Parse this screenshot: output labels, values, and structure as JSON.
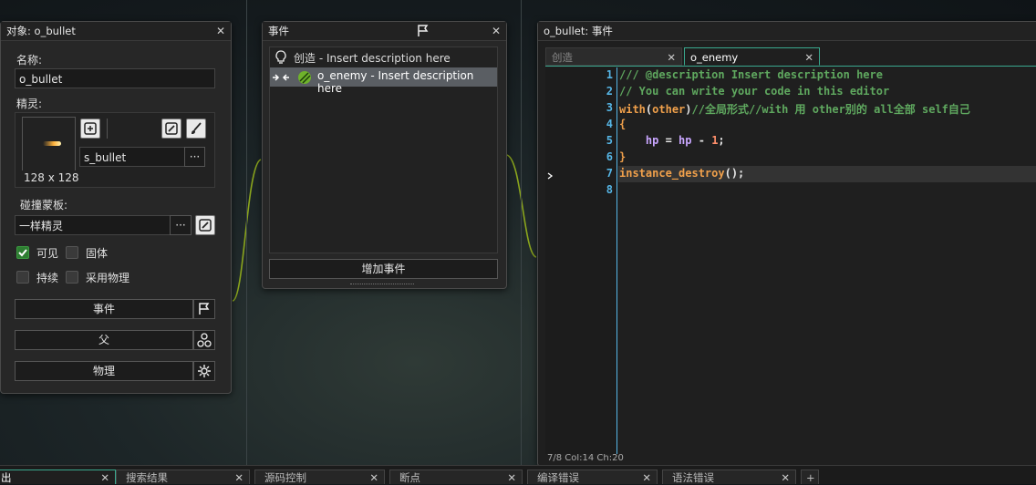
{
  "object_panel": {
    "title": "对象: o_bullet",
    "name_label": "名称:",
    "name_value": "o_bullet",
    "sprite_label": "精灵:",
    "sprite_name": "s_bullet",
    "sprite_size": "128 x 128",
    "ellipsis": "···",
    "collision_label": "碰撞蒙板:",
    "collision_value": "一样精灵",
    "visible_label": "可见",
    "solid_label": "固体",
    "persistent_label": "持续",
    "physics_use_label": "采用物理",
    "visible_checked": true,
    "solid_checked": false,
    "persistent_checked": false,
    "physics_checked": false,
    "events_button": "事件",
    "parent_button": "父",
    "physics_button": "物理"
  },
  "events_panel": {
    "title": "事件",
    "events": [
      {
        "label": "创造 - Insert description here",
        "icon": "lightbulb-icon",
        "selected": false
      },
      {
        "label": "o_enemy - Insert description here",
        "icon": "collision-icon",
        "selected": true
      }
    ],
    "add_event_button": "增加事件"
  },
  "code_panel": {
    "title": "o_bullet: 事件",
    "tabs": [
      {
        "label": "创造",
        "active": false
      },
      {
        "label": "o_enemy",
        "active": true
      }
    ],
    "lines": [
      {
        "num": "1",
        "parts": [
          {
            "t": "/// @description Insert description here",
            "c": "#5fa85f"
          }
        ]
      },
      {
        "num": "2",
        "parts": [
          {
            "t": "// You can write your code in this editor",
            "c": "#5fa85f"
          }
        ]
      },
      {
        "num": "3",
        "parts": [
          {
            "t": "with",
            "c": "#f0a04b"
          },
          {
            "t": "(",
            "c": "#e6e6e6"
          },
          {
            "t": "other",
            "c": "#f0a04b"
          },
          {
            "t": ")",
            "c": "#e6e6e6"
          },
          {
            "t": "//全局形式//with 用 other别的 all全部 self自己",
            "c": "#5fa85f"
          }
        ]
      },
      {
        "num": "4",
        "parts": [
          {
            "t": "{",
            "c": "#f0a04b"
          }
        ]
      },
      {
        "num": "5",
        "parts": [
          {
            "t": "    ",
            "c": "#e6e6e6"
          },
          {
            "t": "hp",
            "c": "#c9a6ff"
          },
          {
            "t": " = ",
            "c": "#e6e6e6"
          },
          {
            "t": "hp",
            "c": "#c9a6ff"
          },
          {
            "t": " - ",
            "c": "#e6e6e6"
          },
          {
            "t": "1",
            "c": "#ff8f6b"
          },
          {
            "t": ";",
            "c": "#e6e6e6"
          }
        ]
      },
      {
        "num": "6",
        "parts": [
          {
            "t": "}",
            "c": "#f0a04b"
          }
        ]
      },
      {
        "num": "7",
        "parts": [
          {
            "t": "instance_destroy",
            "c": "#f0a04b"
          },
          {
            "t": "();",
            "c": "#e6e6e6"
          }
        ]
      },
      {
        "num": "8",
        "parts": []
      }
    ],
    "current_line": 7,
    "status": "7/8 Col:14 Ch:20"
  },
  "bottom_tabs": [
    {
      "label": "出"
    },
    {
      "label": "搜索结果"
    },
    {
      "label": "源码控制"
    },
    {
      "label": "断点"
    },
    {
      "label": "编译错误"
    },
    {
      "label": "语法错误"
    }
  ],
  "add_tab": "+",
  "close_glyph": "✕"
}
